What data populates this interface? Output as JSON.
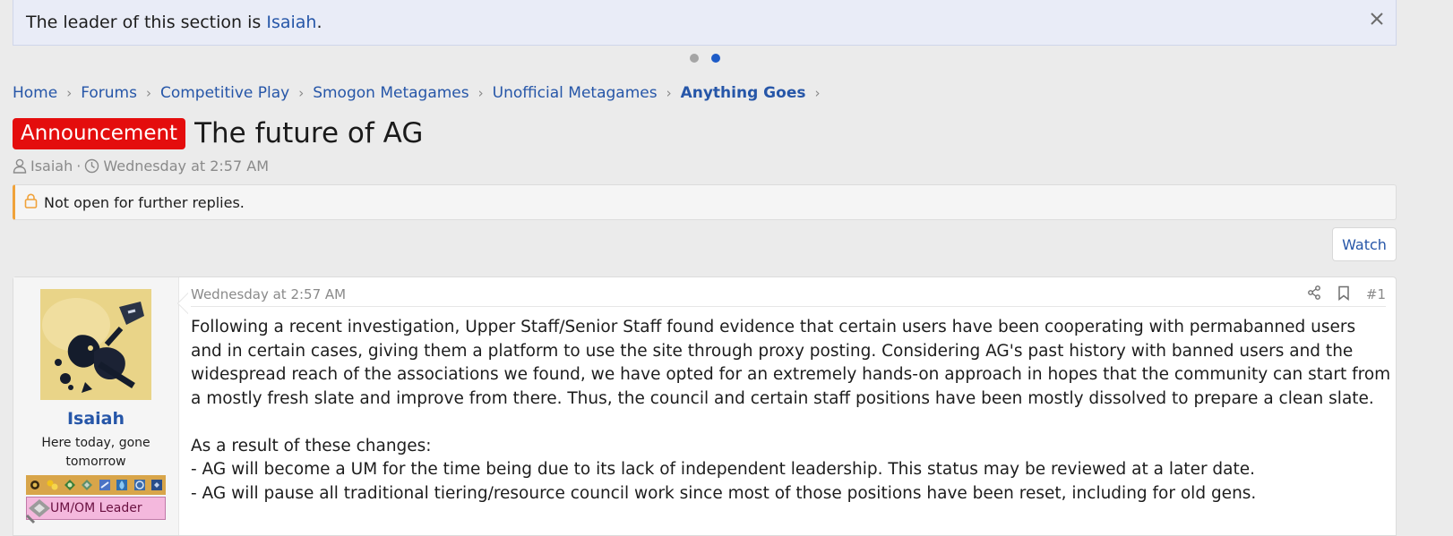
{
  "notice": {
    "text_prefix": "The leader of this section is ",
    "name": "Isaiah",
    "text_suffix": ".",
    "close_icon": "close-icon"
  },
  "carousel": {
    "dots": 2,
    "active": 2
  },
  "breadcrumb": [
    {
      "label": "Home"
    },
    {
      "label": "Forums"
    },
    {
      "label": "Competitive Play"
    },
    {
      "label": "Smogon Metagames"
    },
    {
      "label": "Unofficial Metagames"
    },
    {
      "label": "Anything Goes"
    }
  ],
  "thread": {
    "prefix": "Announcement",
    "prefix_color": "#e40d0d",
    "title": "The future of AG",
    "author": "Isaiah",
    "separator": "·",
    "date": "Wednesday at 2:57 AM"
  },
  "closed_notice": {
    "text": "Not open for further replies.",
    "icon": "lock-icon",
    "accent_color": "#f0a23a"
  },
  "watch_button": {
    "label": "Watch"
  },
  "post": {
    "date": "Wednesday at 2:57 AM",
    "number": "#1",
    "user": {
      "name": "Isaiah",
      "title": "Here today, gone tomorrow",
      "role": "UM/OM Leader"
    },
    "body": {
      "paragraph1": "Following a recent investigation, Upper Staff/Senior Staff found evidence that certain users have been cooperating with permabanned users and in certain cases, giving them a platform to use the site through proxy posting. Considering AG's past history with banned users and the widespread reach of the associations we found, we have opted for an extremely hands-on approach in hopes that the community can start from a mostly fresh slate and improve from there. Thus, the council and certain staff positions have been mostly dissolved to prepare a clean slate.",
      "intro": "As a result of these changes:",
      "item1": "- AG will become a UM for the time being due to its lack of independent leadership. This status may be reviewed at a later date.",
      "item2": "- AG will pause all traditional tiering/resource council work since most of those positions have been reset, including for old gens."
    }
  }
}
